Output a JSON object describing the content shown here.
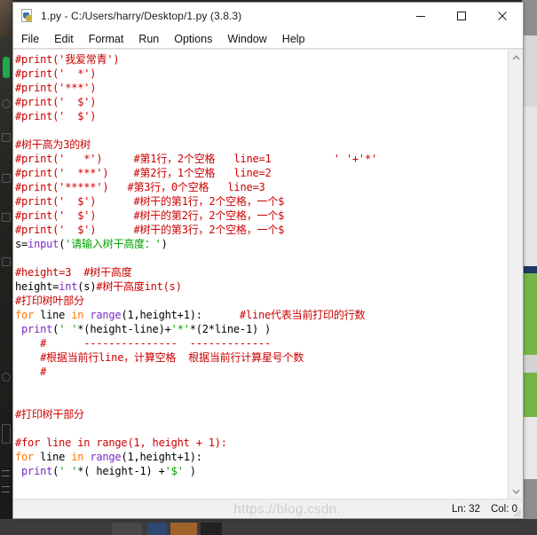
{
  "window": {
    "title": "1.py - C:/Users/harry/Desktop/1.py (3.8.3)",
    "app_icon": "python-file-icon",
    "buttons": {
      "minimize": "minimize-icon",
      "maximize": "maximize-icon",
      "close": "close-icon"
    }
  },
  "menubar": {
    "items": [
      {
        "label": "File"
      },
      {
        "label": "Edit"
      },
      {
        "label": "Format"
      },
      {
        "label": "Run"
      },
      {
        "label": "Options"
      },
      {
        "label": "Window"
      },
      {
        "label": "Help"
      }
    ]
  },
  "editor": {
    "lines": [
      [
        {
          "t": "#print('我爱常青')",
          "c": "comment"
        }
      ],
      [
        {
          "t": "#print('  *')",
          "c": "comment"
        }
      ],
      [
        {
          "t": "#print('***')",
          "c": "comment"
        }
      ],
      [
        {
          "t": "#print('  $')",
          "c": "comment"
        }
      ],
      [
        {
          "t": "#print('  $')",
          "c": "comment"
        }
      ],
      [
        {
          "t": "",
          "c": "plain"
        }
      ],
      [
        {
          "t": "#树干高为3的树",
          "c": "comment"
        }
      ],
      [
        {
          "t": "#print('   *')     #第1行，2个空格   line=1          ' '+'*'",
          "c": "comment"
        }
      ],
      [
        {
          "t": "#print('  ***')    #第2行，1个空格   line=2",
          "c": "comment"
        }
      ],
      [
        {
          "t": "#print('*****')   #第3行，0个空格   line=3",
          "c": "comment"
        }
      ],
      [
        {
          "t": "#print('  $')      #树干的第1行，2个空格，一个$",
          "c": "comment"
        }
      ],
      [
        {
          "t": "#print('  $')      #树干的第2行，2个空格，一个$",
          "c": "comment"
        }
      ],
      [
        {
          "t": "#print('  $')      #树干的第3行，2个空格，一个$",
          "c": "comment"
        }
      ],
      [
        {
          "t": "s=",
          "c": "plain"
        },
        {
          "t": "input",
          "c": "builtin"
        },
        {
          "t": "(",
          "c": "plain"
        },
        {
          "t": "'请输入树干高度：'",
          "c": "string"
        },
        {
          "t": ")",
          "c": "plain"
        }
      ],
      [
        {
          "t": "",
          "c": "plain"
        }
      ],
      [
        {
          "t": "#height=3  #树干高度",
          "c": "comment"
        }
      ],
      [
        {
          "t": "height=",
          "c": "plain"
        },
        {
          "t": "int",
          "c": "builtin"
        },
        {
          "t": "(s)",
          "c": "plain"
        },
        {
          "t": "#树干高度int(s)",
          "c": "comment"
        }
      ],
      [
        {
          "t": "#打印树叶部分",
          "c": "comment"
        }
      ],
      [
        {
          "t": "for",
          "c": "kw"
        },
        {
          "t": " line ",
          "c": "plain"
        },
        {
          "t": "in",
          "c": "kw"
        },
        {
          "t": " ",
          "c": "plain"
        },
        {
          "t": "range",
          "c": "builtin"
        },
        {
          "t": "(1,height+1):      ",
          "c": "plain"
        },
        {
          "t": "#line代表当前打印的行数",
          "c": "comment"
        }
      ],
      [
        {
          "t": " ",
          "c": "plain"
        },
        {
          "t": "print",
          "c": "builtin"
        },
        {
          "t": "(",
          "c": "plain"
        },
        {
          "t": "' '",
          "c": "string"
        },
        {
          "t": "*(height-line)+",
          "c": "plain"
        },
        {
          "t": "'*'",
          "c": "string"
        },
        {
          "t": "*(2*line-1) )",
          "c": "plain"
        }
      ],
      [
        {
          "t": "    #      ---------------  -------------",
          "c": "comment"
        }
      ],
      [
        {
          "t": "    #根据当前行line，计算空格  根据当前行计算星号个数",
          "c": "comment"
        }
      ],
      [
        {
          "t": "    #",
          "c": "comment"
        }
      ],
      [
        {
          "t": "",
          "c": "plain"
        }
      ],
      [
        {
          "t": "",
          "c": "plain"
        }
      ],
      [
        {
          "t": "#打印树干部分",
          "c": "comment"
        }
      ],
      [
        {
          "t": "",
          "c": "plain"
        }
      ],
      [
        {
          "t": "#for line in range(1, height + 1):",
          "c": "comment"
        }
      ],
      [
        {
          "t": "for",
          "c": "kw"
        },
        {
          "t": " line ",
          "c": "plain"
        },
        {
          "t": "in",
          "c": "kw"
        },
        {
          "t": " ",
          "c": "plain"
        },
        {
          "t": "range",
          "c": "builtin"
        },
        {
          "t": "(1,height+1):",
          "c": "plain"
        }
      ],
      [
        {
          "t": " ",
          "c": "plain"
        },
        {
          "t": "print",
          "c": "builtin"
        },
        {
          "t": "(",
          "c": "plain"
        },
        {
          "t": "' '",
          "c": "string"
        },
        {
          "t": "*( height-1) +",
          "c": "plain"
        },
        {
          "t": "'$'",
          "c": "string"
        },
        {
          "t": " )",
          "c": "plain"
        }
      ]
    ]
  },
  "scrollbar": {
    "up_arrow": "chevron-up-icon",
    "down_arrow": "chevron-down-icon"
  },
  "statusbar": {
    "line_label": "Ln: 32",
    "col_label": "Col: 0",
    "watermark": "https://blog.csdn."
  }
}
